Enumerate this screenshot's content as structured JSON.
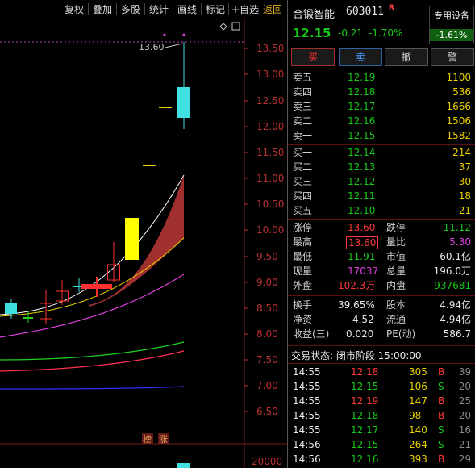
{
  "toolbar": {
    "items": [
      "复权",
      "叠加",
      "多股",
      "统计",
      "画线",
      "标记",
      "+自选",
      "返回"
    ]
  },
  "chart": {
    "price_axis": [
      "13.50",
      "13.00",
      "12.50",
      "12.00",
      "11.50",
      "11.00",
      "10.50",
      "10.00",
      "9.50",
      "9.00",
      "8.50",
      "8.00",
      "7.50",
      "7.00",
      "6.50"
    ],
    "high_marker": "13.60",
    "volume_axis": "20000",
    "tags": [
      "榜",
      "涨"
    ],
    "colors": {
      "up": "#ff3030",
      "down": "#40e0e0",
      "ma_white": "#ffffff",
      "ma_yellow": "#e8d000",
      "ma_magenta": "#e040e0",
      "ma_green": "#20d020",
      "ma_red": "#ff3050",
      "ma_blue": "#3030ff",
      "band_fill": "#a03030"
    }
  },
  "quote": {
    "name": "合锻智能",
    "code": "603011",
    "r_badge": "R",
    "price": "12.15",
    "change": "-0.21",
    "change_pct": "-1.70%",
    "sector_name": "专用设备",
    "sector_change": "-1.61%"
  },
  "buttons": {
    "buy": "买",
    "sell": "卖",
    "cancel": "撤",
    "alert": "警"
  },
  "asks": [
    {
      "label": "卖五",
      "price": "12.19",
      "vol": "1100"
    },
    {
      "label": "卖四",
      "price": "12.18",
      "vol": "536"
    },
    {
      "label": "卖三",
      "price": "12.17",
      "vol": "1666"
    },
    {
      "label": "卖二",
      "price": "12.16",
      "vol": "1506"
    },
    {
      "label": "卖一",
      "price": "12.15",
      "vol": "1582"
    }
  ],
  "bids": [
    {
      "label": "买一",
      "price": "12.14",
      "vol": "214"
    },
    {
      "label": "买二",
      "price": "12.13",
      "vol": "37"
    },
    {
      "label": "买三",
      "price": "12.12",
      "vol": "30"
    },
    {
      "label": "买四",
      "price": "12.11",
      "vol": "18"
    },
    {
      "label": "买五",
      "price": "12.10",
      "vol": "21"
    }
  ],
  "stats1": [
    {
      "l1": "涨停",
      "v1": "13.60",
      "l2": "跌停",
      "v2": "11.12"
    },
    {
      "l1": "最高",
      "v1": "13.60",
      "l2": "量比",
      "v2": "5.30"
    },
    {
      "l1": "最低",
      "v1": "11.91",
      "l2": "市值",
      "v2": "60.1亿"
    },
    {
      "l1": "现量",
      "v1": "17037",
      "l2": "总量",
      "v2": "196.0万"
    },
    {
      "l1": "外盘",
      "v1": "102.3万",
      "l2": "内盘",
      "v2": "937681"
    }
  ],
  "stats2": [
    {
      "l1": "换手",
      "v1": "39.65%",
      "l2": "股本",
      "v2": "4.94亿"
    },
    {
      "l1": "净资",
      "v1": "4.52",
      "l2": "流通",
      "v2": "4.94亿"
    },
    {
      "l1": "收益(三)",
      "v1": "0.020",
      "l2": "PE(动)",
      "v2": "586.7"
    }
  ],
  "trade_status": "交易状态: 闭市阶段 15:00:00",
  "ticks": [
    {
      "time": "14:55",
      "price": "12.18",
      "vol": "305",
      "side": "B",
      "n": "39"
    },
    {
      "time": "14:55",
      "price": "12.15",
      "vol": "106",
      "side": "S",
      "n": "20"
    },
    {
      "time": "14:55",
      "price": "12.19",
      "vol": "147",
      "side": "B",
      "n": "25"
    },
    {
      "time": "14:55",
      "price": "12.18",
      "vol": "98",
      "side": "B",
      "n": "20"
    },
    {
      "time": "14:55",
      "price": "12.17",
      "vol": "140",
      "side": "S",
      "n": "16"
    },
    {
      "time": "14:56",
      "price": "12.15",
      "vol": "264",
      "side": "S",
      "n": "21"
    },
    {
      "time": "14:56",
      "price": "12.16",
      "vol": "393",
      "side": "B",
      "n": "29"
    }
  ]
}
